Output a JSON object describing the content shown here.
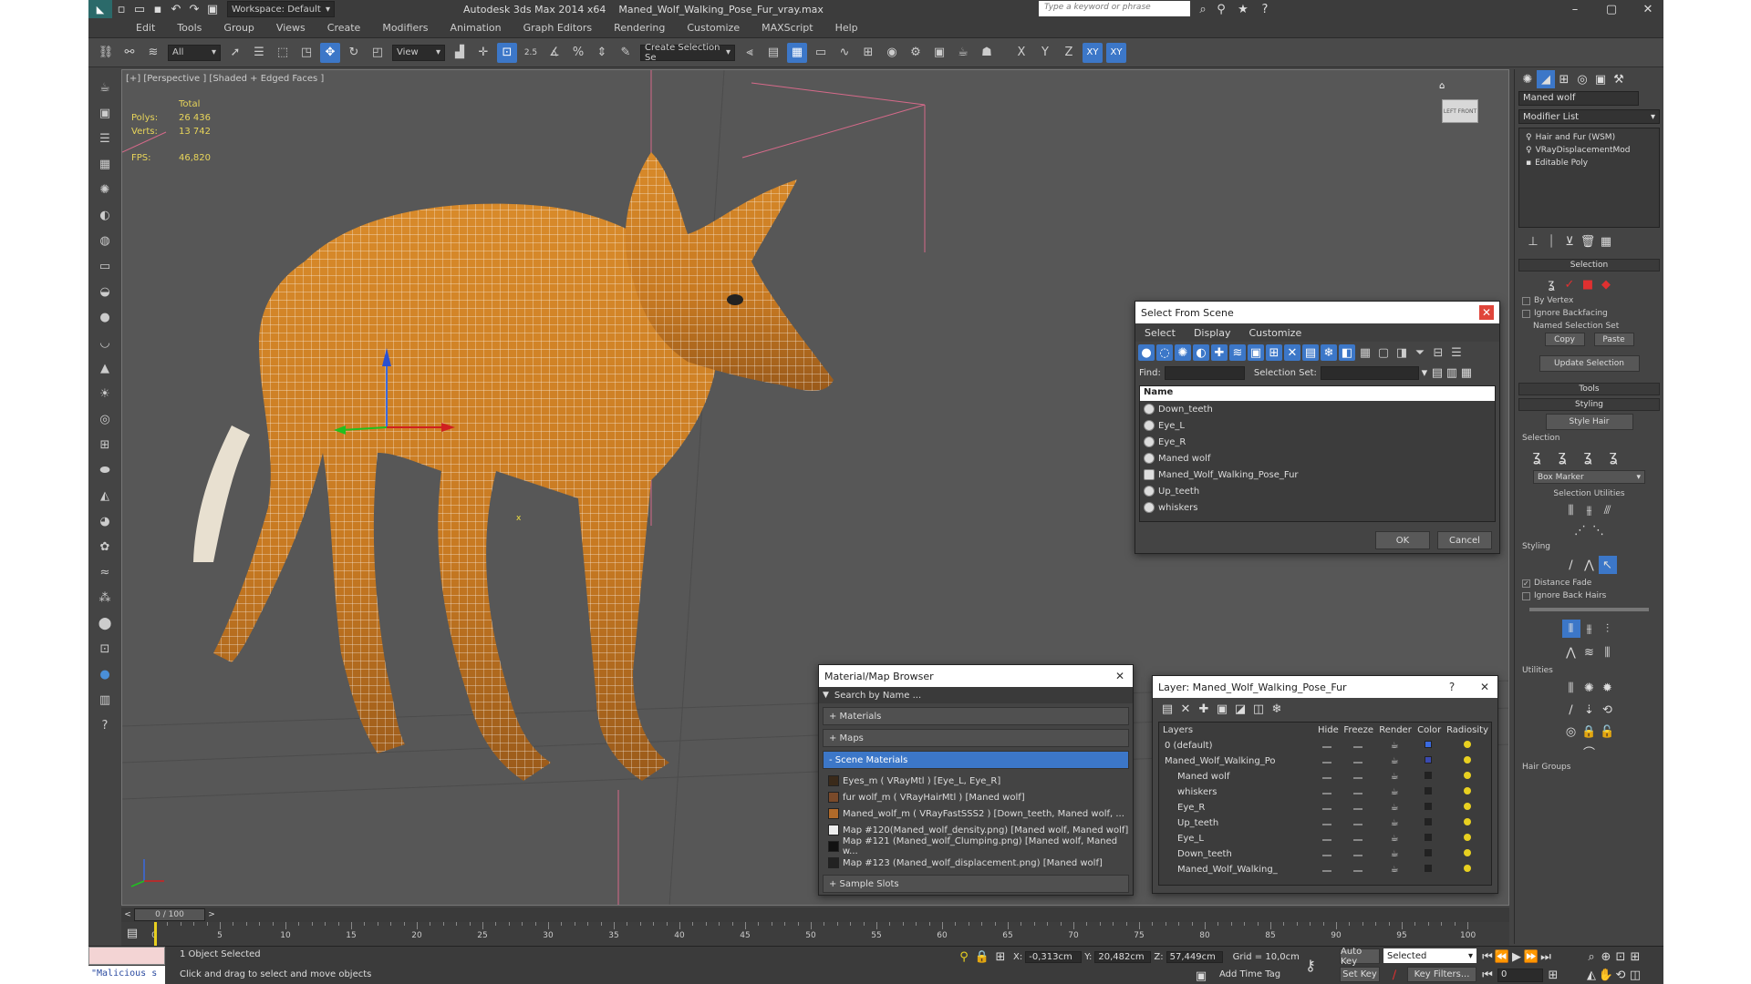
{
  "titlebar": {
    "workspace": "Workspace: Default",
    "app_title": "Autodesk 3ds Max  2014 x64",
    "file_name": "Maned_Wolf_Walking_Pose_Fur_vray.max",
    "search_placeholder": "Type a keyword or phrase"
  },
  "menu": [
    "Edit",
    "Tools",
    "Group",
    "Views",
    "Create",
    "Modifiers",
    "Animation",
    "Graph Editors",
    "Rendering",
    "Customize",
    "MAXScript",
    "Help"
  ],
  "toolbar": {
    "filter_value": "All",
    "refcoord_value": "View",
    "selset_placeholder": "Create Selection Se",
    "axes": [
      "X",
      "Y",
      "Z",
      "XY",
      "XY"
    ],
    "snap_label": "2.5"
  },
  "viewport": {
    "label": "[+] [Perspective ] [Shaded + Edged Faces ]",
    "stats": {
      "header": "Total",
      "polys_label": "Polys:",
      "polys": "26 436",
      "verts_label": "Verts:",
      "verts": "13 742",
      "fps_label": "FPS:",
      "fps": "46,820"
    },
    "viewcube_left": "LEFT",
    "viewcube_front": "FRONT",
    "axis_x": "x"
  },
  "select_from_scene": {
    "title": "Select From Scene",
    "menu": [
      "Select",
      "Display",
      "Customize"
    ],
    "find_label": "Find:",
    "selset_label": "Selection Set:",
    "column": "Name",
    "items": [
      "Down_teeth",
      "Eye_L",
      "Eye_R",
      "Maned wolf",
      "Maned_Wolf_Walking_Pose_Fur",
      "Up_teeth",
      "whiskers"
    ],
    "ok": "OK",
    "cancel": "Cancel"
  },
  "material_browser": {
    "title": "Material/Map Browser",
    "search_placeholder": "Search by Name ...",
    "sections": [
      "+ Materials",
      "+ Maps",
      "- Scene Materials"
    ],
    "materials": [
      "Eyes_m  ( VRayMtl )  [Eye_L, Eye_R]",
      "fur wolf_m  ( VRayHairMtl )  [Maned wolf]",
      "Maned_wolf_m  ( VRayFastSSS2 )  [Down_teeth, Maned wolf, ...",
      "Map #120(Maned_wolf_density.png)  [Maned wolf, Maned wolf]",
      "Map #121 (Maned_wolf_Clumping.png)  [Maned wolf, Maned w...",
      "Map #123 (Maned_wolf_displacement.png)  [Maned wolf]"
    ],
    "sample_slots": "+ Sample Slots"
  },
  "layer_window": {
    "title": "Layer: Maned_Wolf_Walking_Pose_Fur",
    "help": "?",
    "columns": [
      "Layers",
      "Hide",
      "Freeze",
      "Render",
      "Color",
      "Radiosity"
    ],
    "rows": [
      "0 (default)",
      "Maned_Wolf_Walking_Po",
      "Maned wolf",
      "whiskers",
      "Eye_R",
      "Up_teeth",
      "Eye_L",
      "Down_teeth",
      "Maned_Wolf_Walking_"
    ]
  },
  "command_panel": {
    "object_name": "Maned wolf",
    "modifier_list": "Modifier List",
    "stack": [
      "Hair and Fur (WSM)",
      "VRayDisplacementMod",
      "Editable Poly"
    ],
    "selection_title": "Selection",
    "by_vertex": "By Vertex",
    "ignore_backfacing": "Ignore Backfacing",
    "named_sel": "Named Selection Set",
    "copy": "Copy",
    "paste": "Paste",
    "update_sel": "Update Selection",
    "tools": "Tools",
    "styling": "Styling",
    "style_hair": "Style Hair",
    "selection_sub": "Selection",
    "box_marker": "Box Marker",
    "selection_utilities": "Selection Utilities",
    "styling_sub": "Styling",
    "distance_fade": "Distance Fade",
    "ignore_back_hairs": "Ignore Back Hairs",
    "utilities": "Utilities",
    "hair_groups": "Hair Groups"
  },
  "timeline": {
    "frame_counter": "0 / 100",
    "ticks": [
      0,
      5,
      10,
      15,
      20,
      25,
      30,
      35,
      40,
      45,
      50,
      55,
      60,
      65,
      70,
      75,
      80,
      85,
      90,
      95,
      100
    ]
  },
  "status": {
    "maxscript": "\"Malicious s",
    "selected": "1 Object Selected",
    "prompt": "Click and drag to select and move objects",
    "x_label": "X:",
    "x": "-0,313cm",
    "y_label": "Y:",
    "y": "20,482cm",
    "z_label": "Z:",
    "z": "57,449cm",
    "grid": "Grid = 10,0cm",
    "add_time_tag": "Add Time Tag",
    "auto_key": "Auto Key",
    "set_key": "Set Key",
    "selected_dd": "Selected",
    "key_filters": "Key Filters...",
    "frame": "0"
  }
}
